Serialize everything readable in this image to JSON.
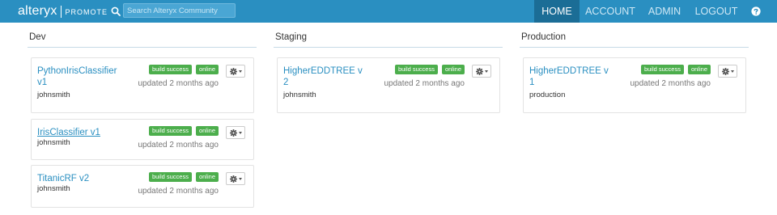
{
  "brand": {
    "name": "alteryx",
    "product": "PROMOTE"
  },
  "search": {
    "placeholder": "Search Alteryx Community",
    "value": ""
  },
  "nav": {
    "home": "HOME",
    "account": "ACCOUNT",
    "admin": "ADMIN",
    "logout": "LOGOUT"
  },
  "icons": {
    "search": "search-icon",
    "help": "question-circle-icon",
    "gear": "gear-icon",
    "caret": "caret-down-icon"
  },
  "colors": {
    "navbar": "#2a8fc1",
    "nav_active": "#1b6d96",
    "badge": "#4cae4c",
    "link": "#2a8fc1"
  },
  "columns": {
    "dev": {
      "title": "Dev",
      "cards": [
        {
          "name": "PythonIrisClassifier v1",
          "owner": "johnsmith",
          "build": "build success",
          "status": "online",
          "updated": "updated 2 months ago"
        },
        {
          "name": "IrisClassifier v1",
          "owner": "johnsmith",
          "build": "build success",
          "status": "online",
          "updated": "updated 2 months ago"
        },
        {
          "name": "TitanicRF v2",
          "owner": "johnsmith",
          "build": "build success",
          "status": "online",
          "updated": "updated 2 months ago"
        }
      ]
    },
    "staging": {
      "title": "Staging",
      "cards": [
        {
          "name": "HigherEDDTREE v2",
          "owner": "johnsmith",
          "build": "build success",
          "status": "online",
          "updated": "updated 2 months ago"
        }
      ]
    },
    "production": {
      "title": "Production",
      "cards": [
        {
          "name": "HigherEDDTREE v1",
          "owner": "production",
          "build": "build success",
          "status": "online",
          "updated": "updated 2 months ago"
        }
      ]
    }
  }
}
